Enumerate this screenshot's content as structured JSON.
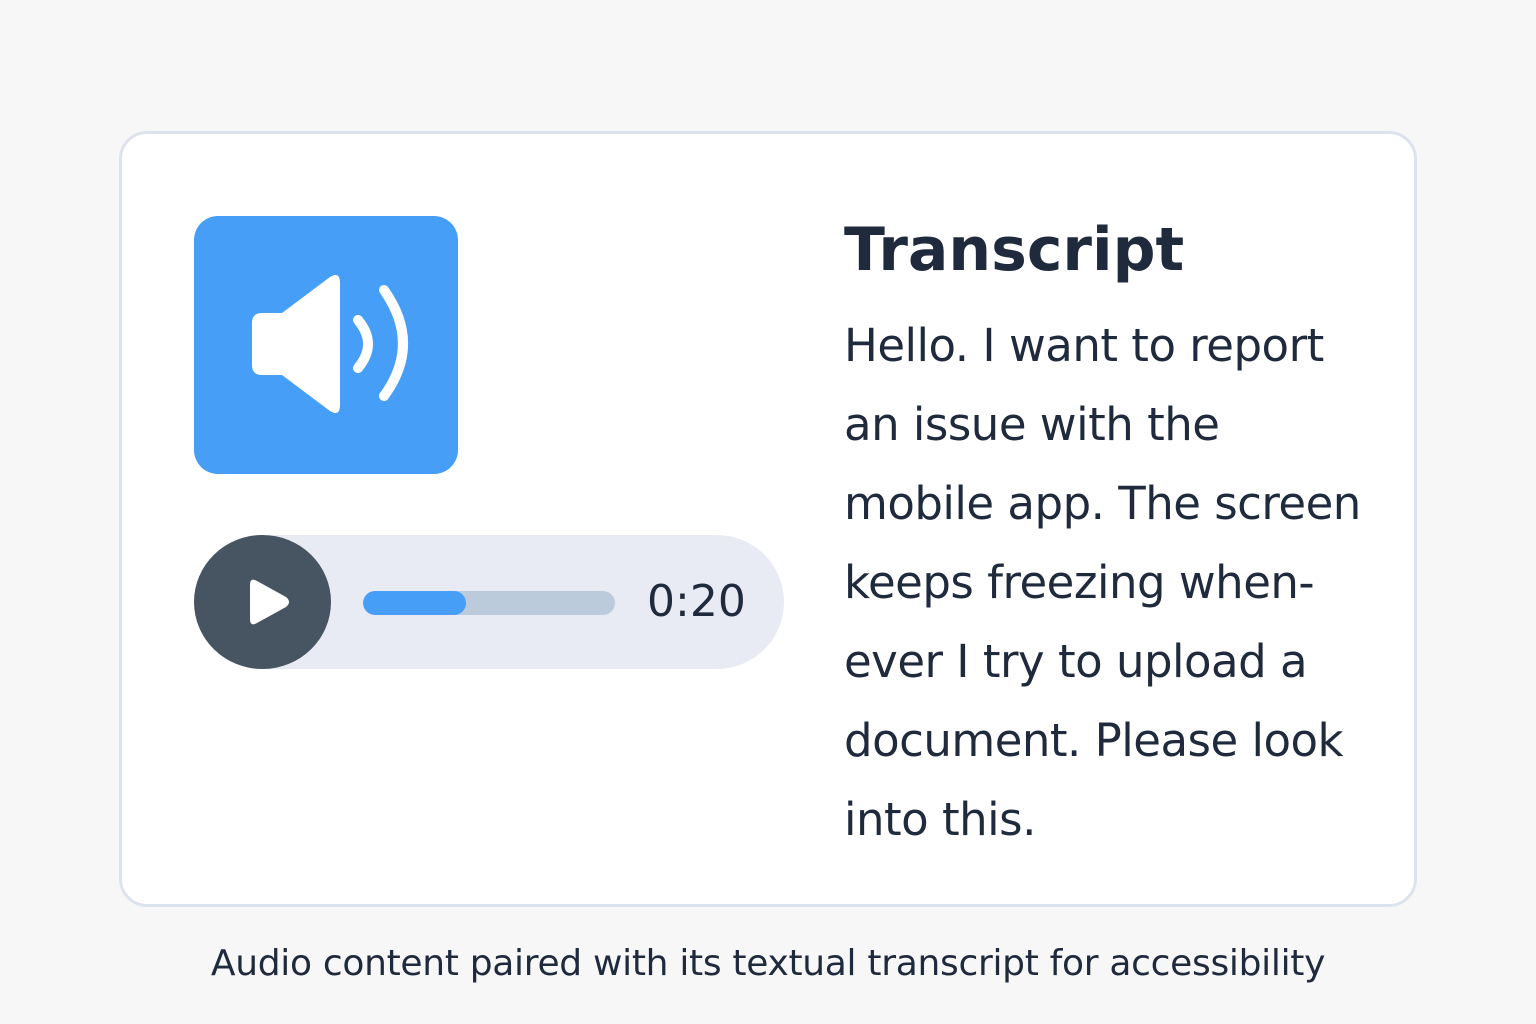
{
  "card": {
    "transcript_title": "Transcript",
    "transcript_lines": [
      "Hello. I want to report",
      "an issue with the",
      "mobile app. The screen",
      "keeps freezing when-",
      "ever I try to upload a",
      "document. Please look",
      "into this."
    ]
  },
  "audio_player": {
    "speaker_icon": "speaker-volume-icon",
    "play_icon": "play-icon",
    "time": "0:20",
    "progress_fraction": 0.41
  },
  "caption": "Audio content paired with its textual transcript for accessibility",
  "colors": {
    "accent_blue": "#479ef6",
    "play_button": "#475563",
    "player_bg": "#e8ebf3",
    "track": "#bccbdc",
    "text": "#1f2a3c",
    "card_border": "#dde3ec",
    "page_bg": "#f7f7f8"
  }
}
